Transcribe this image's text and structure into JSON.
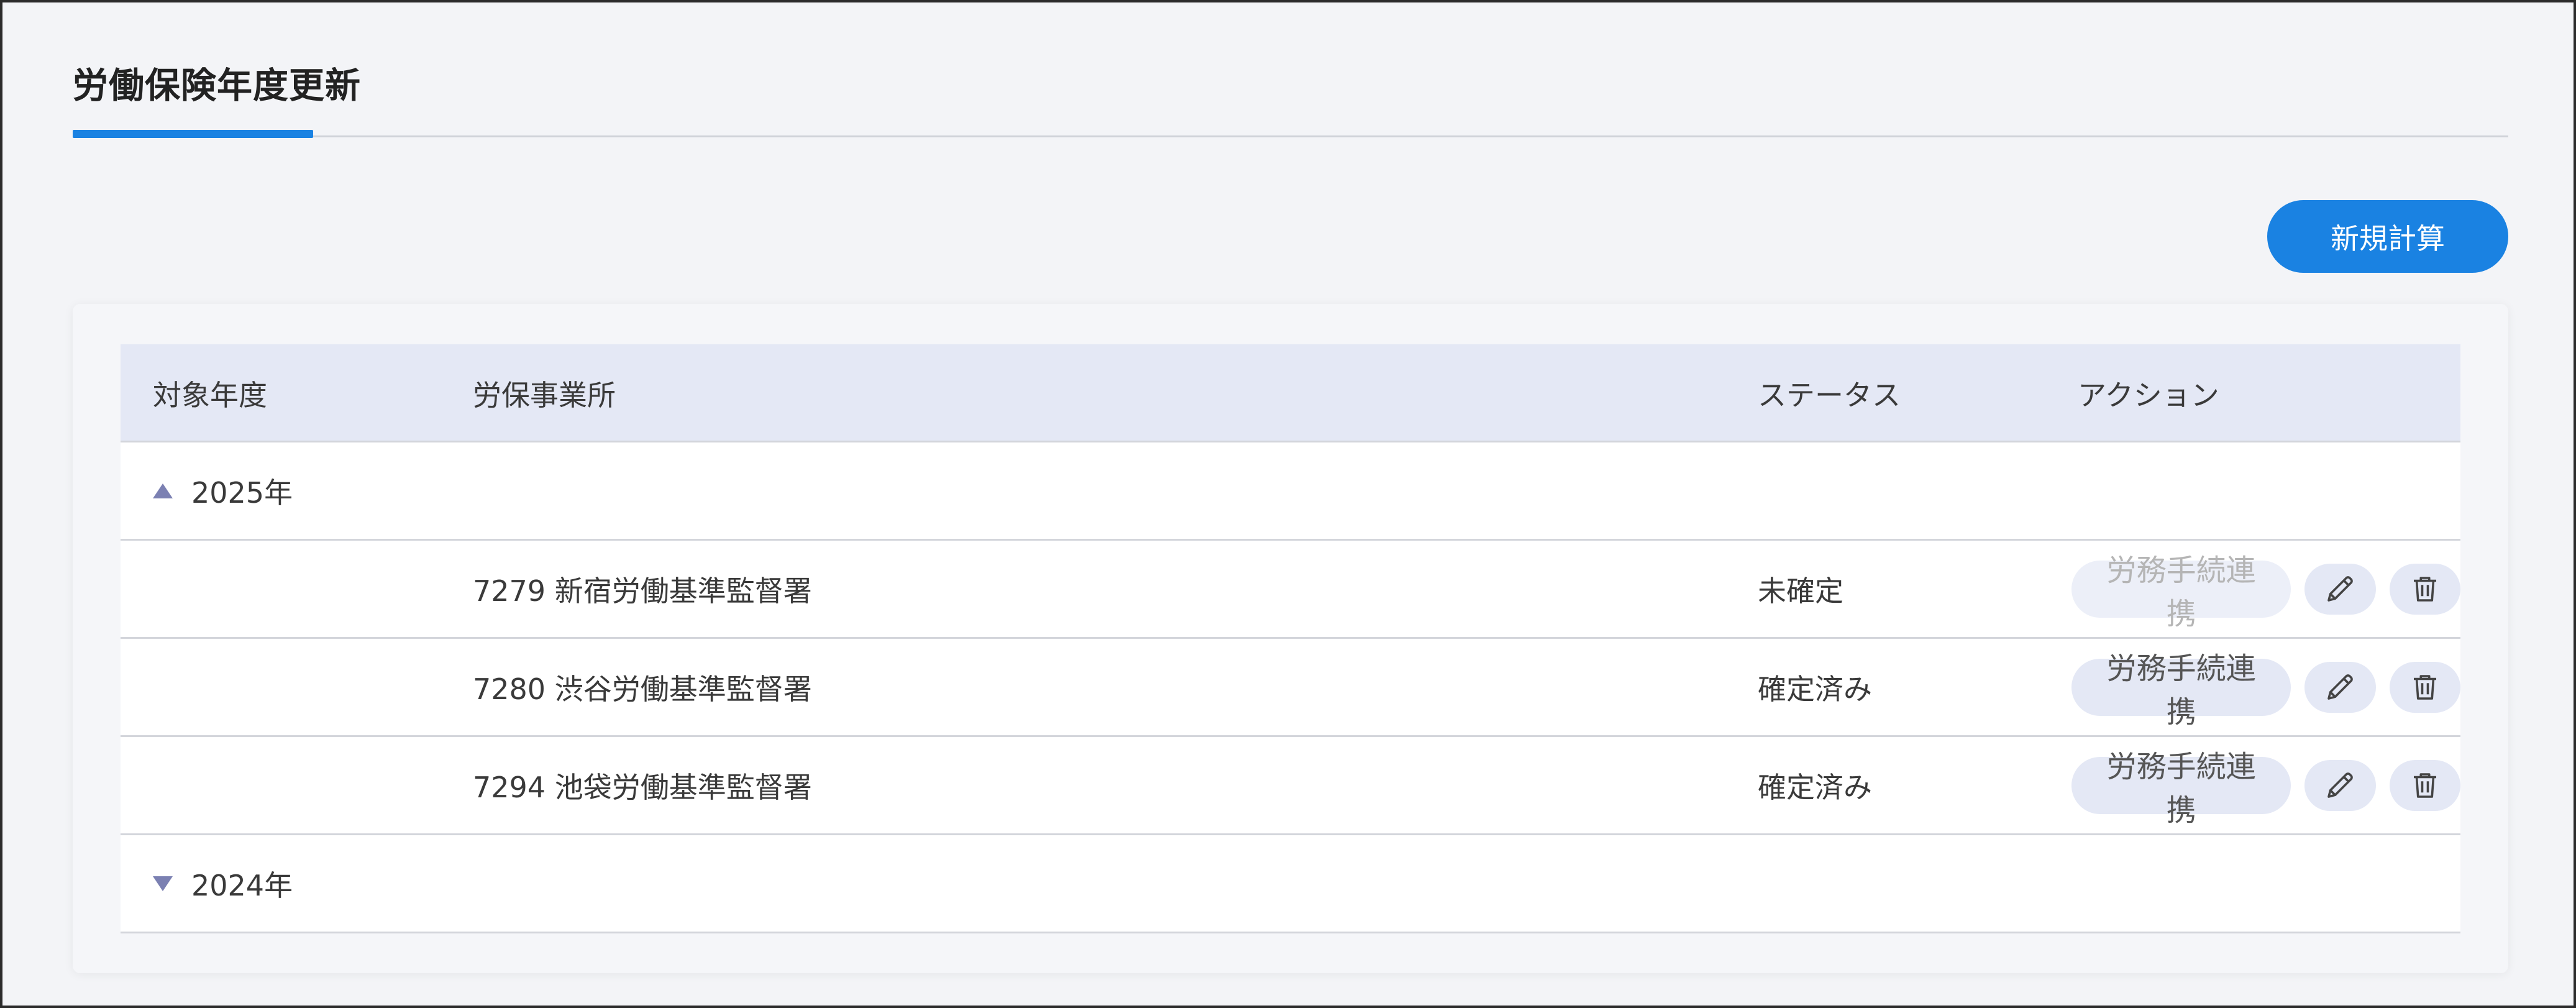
{
  "page": {
    "title": "労働保険年度更新"
  },
  "toolbar": {
    "new_label": "新規計算"
  },
  "table": {
    "headers": [
      "対象年度",
      "労保事業所",
      "ステータス",
      "アクション"
    ],
    "groups": [
      {
        "year": "2025年",
        "expanded": true,
        "rows": [
          {
            "office": "7279 新宿労働基準監督署",
            "status": "未確定",
            "link_label": "労務手続連携",
            "link_enabled": false
          },
          {
            "office": "7280 渋谷労働基準監督署",
            "status": "確定済み",
            "link_label": "労務手続連携",
            "link_enabled": true
          },
          {
            "office": "7294 池袋労働基準監督署",
            "status": "確定済み",
            "link_label": "労務手続連携",
            "link_enabled": true
          }
        ]
      },
      {
        "year": "2024年",
        "expanded": false,
        "rows": []
      }
    ]
  },
  "icons": {
    "edit": "pencil-icon",
    "delete": "trash-icon",
    "expanded": "triangle-up-icon",
    "collapsed": "triangle-down-icon"
  },
  "colors": {
    "accent": "#1a82e2",
    "header_bg": "#e4e8f5"
  }
}
